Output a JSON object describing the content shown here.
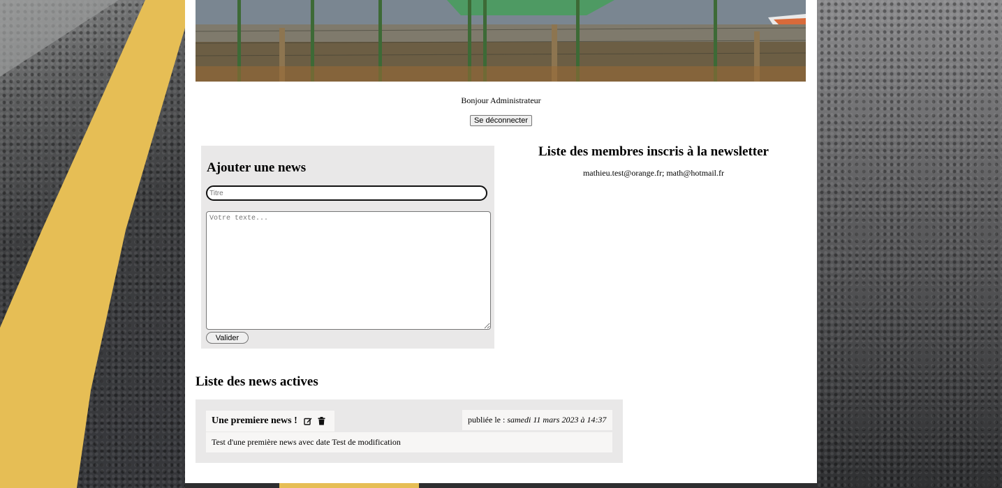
{
  "session": {
    "greeting": "Bonjour Administrateur",
    "logout_label": "Se déconnecter"
  },
  "add_news": {
    "heading": "Ajouter une news",
    "title_placeholder": "Titre",
    "title_value": "",
    "text_placeholder": "Votre texte...",
    "text_value": "",
    "submit_label": "Valider"
  },
  "newsletter": {
    "heading": "Liste des membres inscris à la newsletter",
    "members": "mathieu.test@orange.fr; math@hotmail.fr"
  },
  "active_news": {
    "heading": "Liste des news actives",
    "items": [
      {
        "title": "Une premiere news !",
        "published_prefix": "publiée le : ",
        "published_date": "samedi 11 mars 2023 à 14:37",
        "body": "Test d'une première news avec date Test de modification",
        "edit_icon": "edit-icon",
        "delete_icon": "trash-icon"
      }
    ]
  },
  "colors": {
    "panel_bg": "#e9e8e8",
    "card_bg": "#f7f6f5",
    "road_stripe": "#e6be55"
  }
}
